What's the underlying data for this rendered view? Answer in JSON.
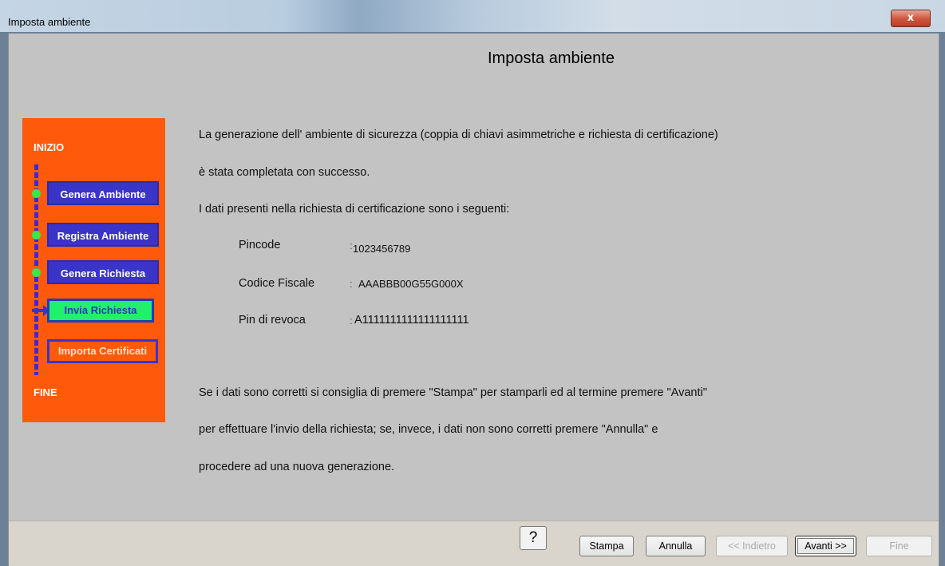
{
  "window": {
    "title": "Imposta ambiente",
    "close_label": "x"
  },
  "page": {
    "title": "Imposta ambiente"
  },
  "steps": {
    "start_label": "INIZIO",
    "end_label": "FINE",
    "items": [
      {
        "label": "Genera Ambiente",
        "state": "completed"
      },
      {
        "label": "Registra Ambiente",
        "state": "completed"
      },
      {
        "label": "Genera Richiesta",
        "state": "completed"
      },
      {
        "label": "Invia Richiesta",
        "state": "current"
      },
      {
        "label": "Importa Certificati",
        "state": "pending"
      }
    ]
  },
  "content": {
    "intro_line1": "La generazione  dell' ambiente  di sicurezza (coppia di chiavi asimmetriche e richiesta di certificazione)",
    "intro_line2": "è stata completata con successo.",
    "intro_line3": "I dati presenti nella richiesta di certificazione sono i seguenti:",
    "fields": [
      {
        "label": "Pincode",
        "value": "1023456789"
      },
      {
        "label": "Codice Fiscale",
        "value": "AAABBB00G55G000X"
      },
      {
        "label": "Pin di revoca",
        "value": "A1111111111111111111"
      }
    ],
    "separator": ":",
    "outro_line1": "Se i dati sono corretti si consiglia di premere \"Stampa\" per stamparli ed al termine premere \"Avanti\"",
    "outro_line2": "per effettuare l'invio della richiesta;  se, invece, i dati non sono corretti premere \"Annulla\" e",
    "outro_line3": "procedere ad una nuova generazione."
  },
  "buttons": {
    "help": "?",
    "print": "Stampa",
    "cancel": "Annulla",
    "back": "<< Indietro",
    "next": "Avanti >>",
    "finish": "Fine"
  }
}
